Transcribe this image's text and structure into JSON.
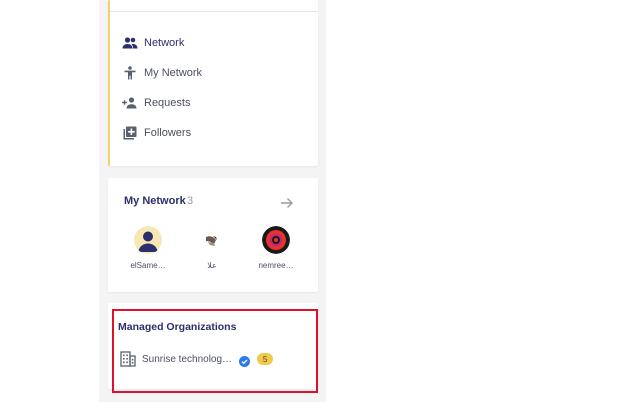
{
  "nav": {
    "items": [
      {
        "label": "Network",
        "icon": "people-icon"
      },
      {
        "label": "My Network",
        "icon": "person-outline-icon"
      },
      {
        "label": "Requests",
        "icon": "person-add-icon"
      },
      {
        "label": "Followers",
        "icon": "library-add-icon"
      }
    ]
  },
  "my_network": {
    "title": "My Network",
    "count": "3",
    "members": [
      {
        "name": "elSame…"
      },
      {
        "name": "علا"
      },
      {
        "name": "nemree…"
      }
    ]
  },
  "managed_orgs": {
    "title": "Managed Organizations",
    "org": {
      "name": "Sunrise technolog…",
      "badge": "5"
    }
  },
  "colors": {
    "accent_navy": "#2b2f6b",
    "highlight_red": "#e0102a",
    "badge_yellow": "#f2c94c",
    "verified_blue": "#2d7be5"
  }
}
